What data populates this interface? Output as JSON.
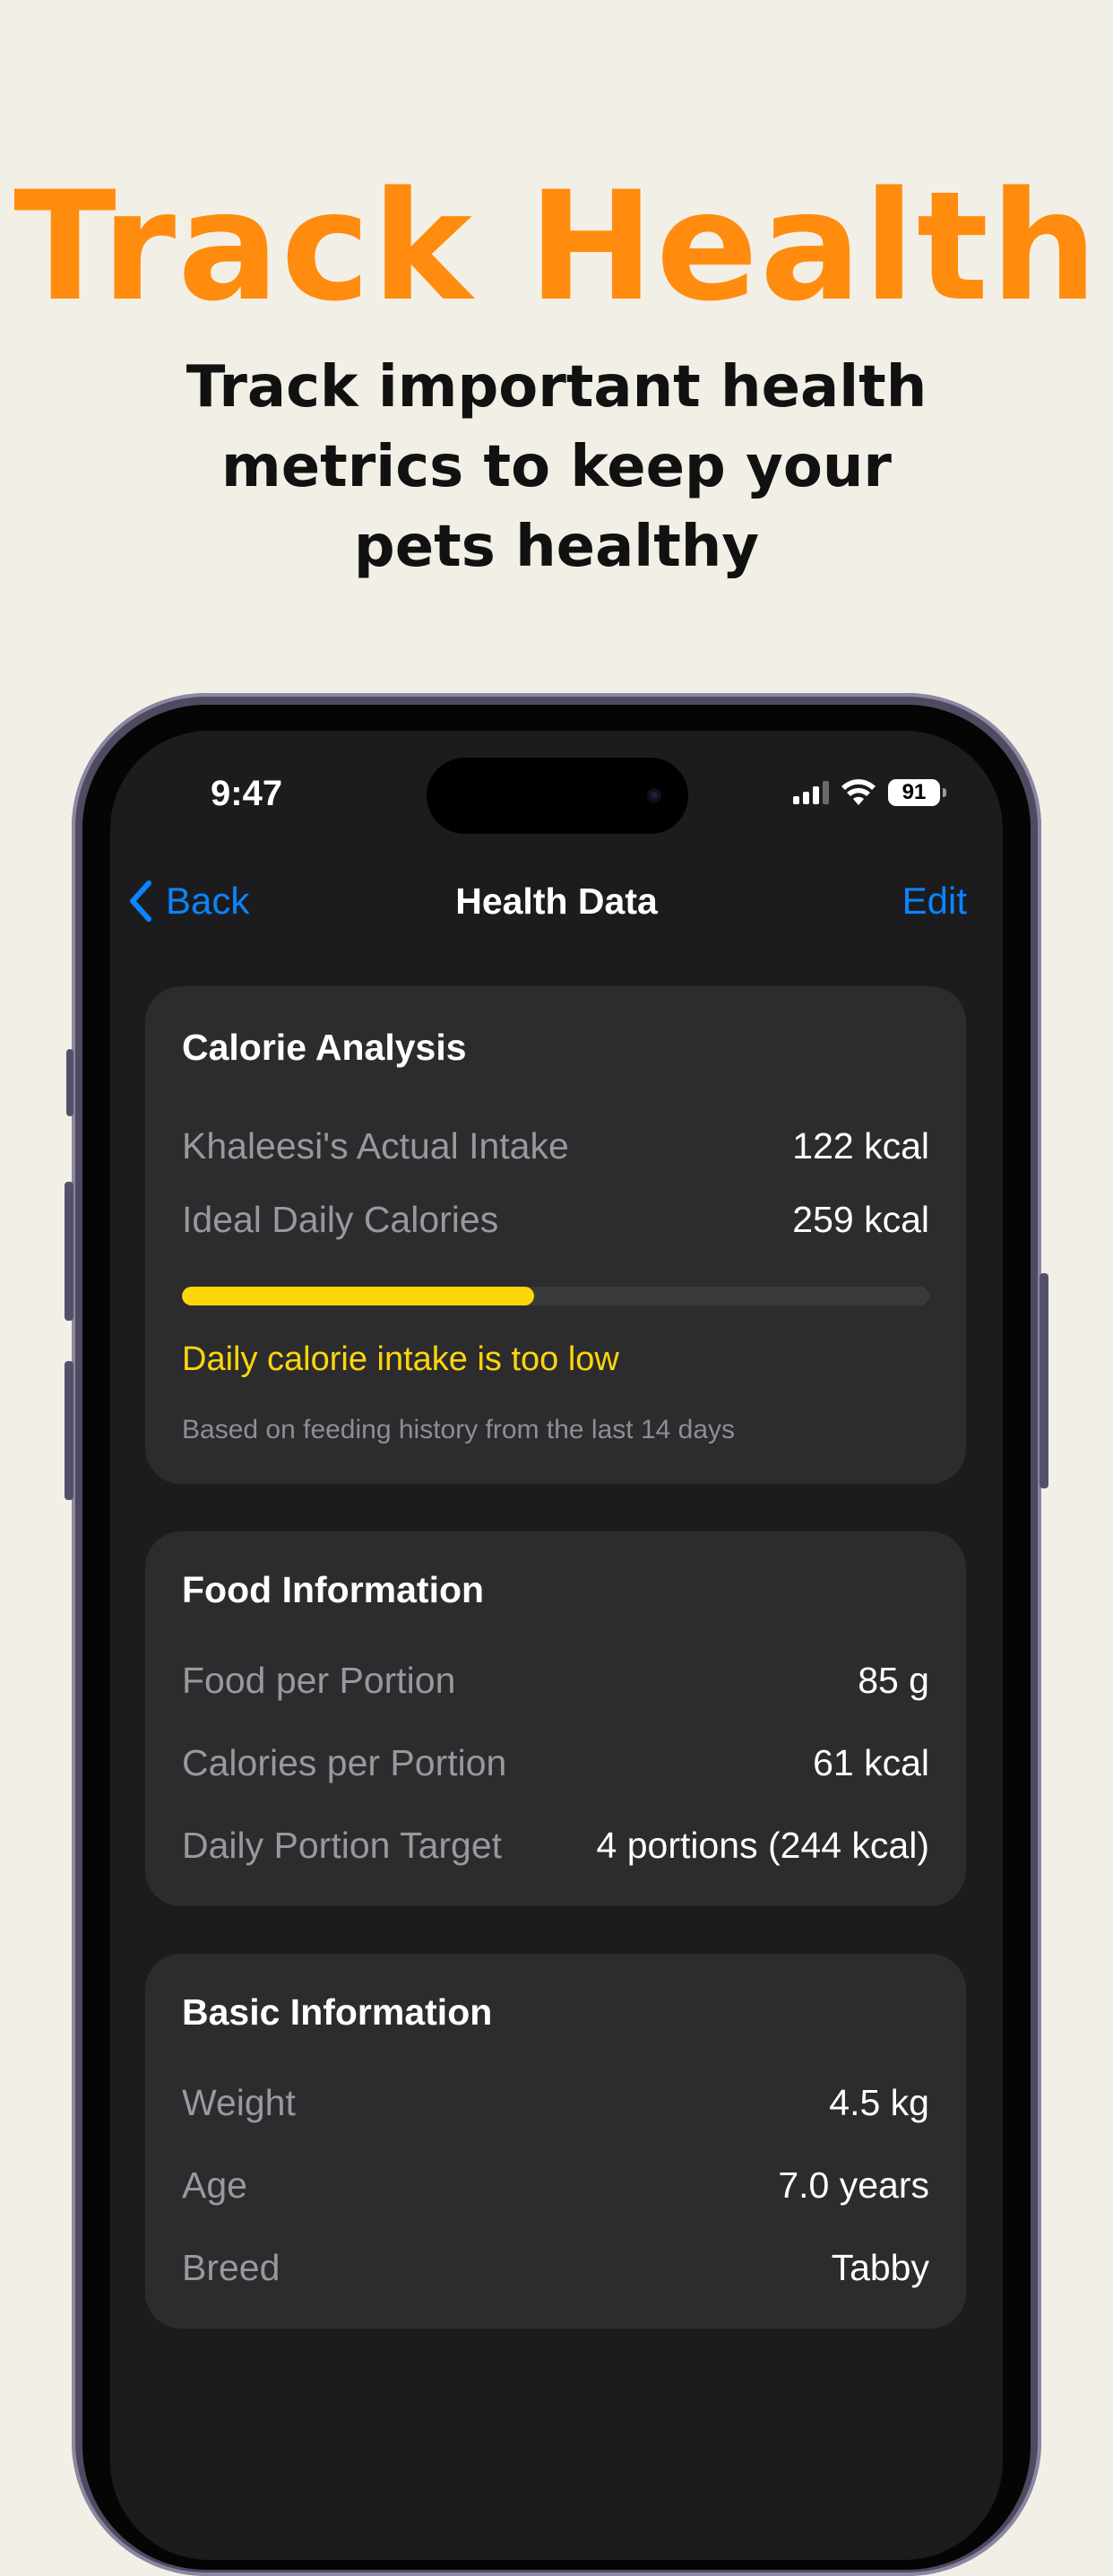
{
  "promo": {
    "headline": "Track Health",
    "subheadline": "Track important health metrics to keep your pets healthy"
  },
  "status_bar": {
    "time": "9:47",
    "battery": "91",
    "icons": [
      "signal-icon",
      "wifi-icon",
      "battery-icon"
    ]
  },
  "nav": {
    "back_label": "Back",
    "title": "Health Data",
    "edit_label": "Edit"
  },
  "calorie_analysis": {
    "title": "Calorie Analysis",
    "rows": [
      {
        "label": "Khaleesi's Actual Intake",
        "value": "122 kcal"
      },
      {
        "label": "Ideal Daily Calories",
        "value": "259 kcal"
      }
    ],
    "progress_fraction": 0.471,
    "warning": "Daily calorie intake is too low",
    "note": "Based on feeding history from the last 14 days"
  },
  "food_information": {
    "title": "Food Information",
    "rows": [
      {
        "label": "Food per Portion",
        "value": "85 g"
      },
      {
        "label": "Calories per Portion",
        "value": "61 kcal"
      },
      {
        "label": "Daily Portion Target",
        "value": "4 portions (244 kcal)"
      }
    ]
  },
  "basic_information": {
    "title": "Basic Information",
    "rows": [
      {
        "label": "Weight",
        "value": "4.5 kg"
      },
      {
        "label": "Age",
        "value": "7.0 years"
      },
      {
        "label": "Breed",
        "value": "Tabby"
      }
    ]
  },
  "colors": {
    "accent_orange": "#ff8c0f",
    "ios_blue": "#0a84ff",
    "warning_yellow": "#ffd60a",
    "background": "#f2f0e6"
  }
}
